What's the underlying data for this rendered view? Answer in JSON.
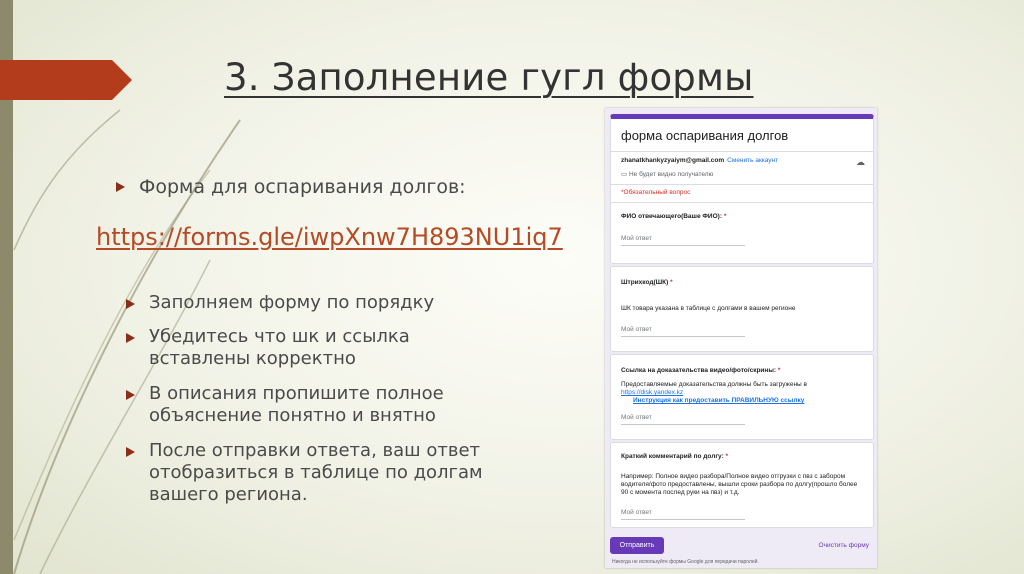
{
  "slide": {
    "title": "3. Заполнение гугл формы",
    "bullet_main": "Форма для оспаривания долгов:",
    "link": "https://forms.gle/iwpXnw7H893NU1iq7",
    "sub_bullets": [
      "Заполняем форму по порядку",
      "Убедитесь что шк и ссылка вставлены корректно",
      "В описания пропишите полное объяснение понятно и внятно",
      "После отправки ответа, ваш ответ отобразиться в таблице по долгам вашего региона."
    ],
    "colors": {
      "accent": "#b33c1c",
      "bullet": "#8b2e17",
      "link": "#b54a24",
      "form_accent": "#673ab7"
    }
  },
  "form": {
    "title": "форма оспаривания долгов",
    "email": "zhanatkhankyzyaiym@gmail.com",
    "switch_account": "Сменить аккаунт",
    "not_shared": "Не будет видно получателю",
    "required_note": "*Обязательный вопрос",
    "questions": [
      {
        "label": "ФИО отвечающего(Ваше ФИО):",
        "star": "*",
        "description": "",
        "answer_placeholder": "Мой ответ"
      },
      {
        "label": "Штрихкод(ШК)",
        "star": "*",
        "description": "ШК товара указана в таблице с долгами в вашем регионе",
        "answer_placeholder": "Мой ответ"
      },
      {
        "label": "Ссылка на доказательства видео/фото/скрины:",
        "star": "*",
        "description": "Предоставляемые доказательства должны быть загружены в",
        "link_text": "https://disk.yandex.kz",
        "instruction": "Инструкция как предоставить ПРАВИЛЬНУЮ ссылку",
        "answer_placeholder": "Мой ответ"
      },
      {
        "label": "Краткий комментарий по долгу:",
        "star": "*",
        "description": "Например: Полное видео разбора/Полное видео отгрузки с пвз с забором водителя/фото предоставлены, вышли сроки разбора по долгу(прошло более 90 с момента послед руки на пвз) и т.д.",
        "answer_placeholder": "Мой ответ"
      }
    ],
    "submit": "Отправить",
    "clear": "Очистить форму",
    "never_submit": "Никогда не используйте формы Google для передачи паролей."
  }
}
